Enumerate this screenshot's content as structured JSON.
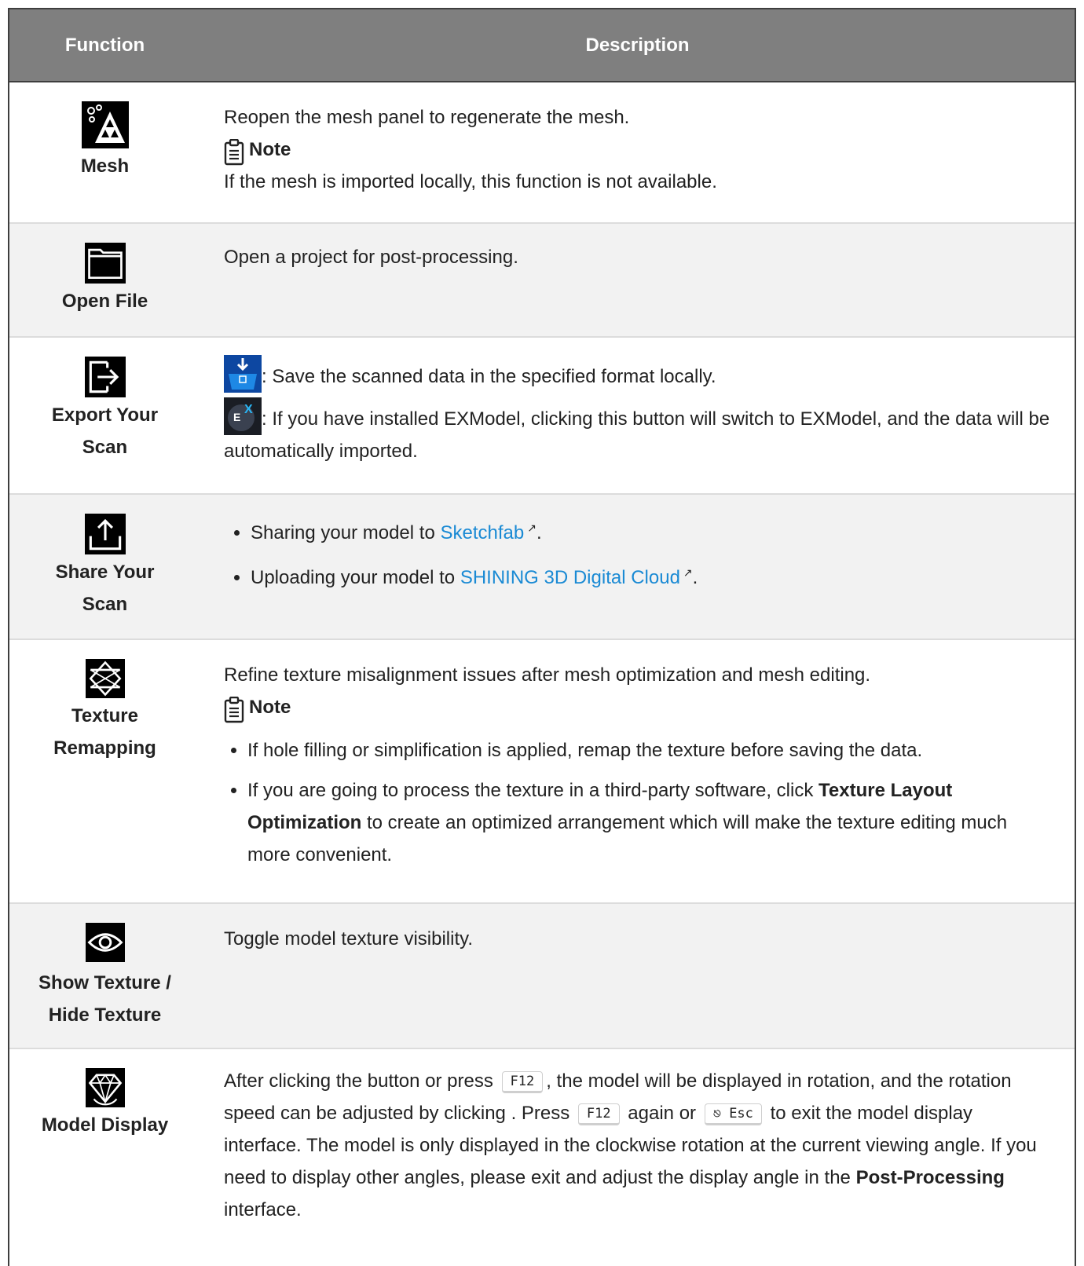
{
  "header": {
    "col1": "Function",
    "col2": "Description"
  },
  "rows": [
    {
      "icon": "mesh-icon",
      "name": "Mesh",
      "text": "Reopen the mesh panel to regenerate the mesh.",
      "note_label": "Note",
      "note_text": "If the mesh is imported locally, this function is not available."
    },
    {
      "icon": "folder-icon",
      "name": "Open File",
      "text": "Open a project for post-processing."
    },
    {
      "icon": "export-icon",
      "name_line1": "Export Your",
      "name_line2": "Scan",
      "line1": ": Save the scanned data in the specified format locally.",
      "line2": ": If you have installed EXModel, clicking this button will switch to EXModel, and the data will be automatically imported."
    },
    {
      "icon": "share-icon",
      "name_line1": "Share Your",
      "name_line2": "Scan",
      "bullet1_pre": "Sharing your model to ",
      "bullet1_link": "Sketchfab",
      "bullet1_post": ".",
      "bullet2_pre": "Uploading your model to ",
      "bullet2_link": "SHINING 3D Digital Cloud",
      "bullet2_post": ".",
      "ext_glyph": "↗"
    },
    {
      "icon": "texture-remap-icon",
      "name_line1": "Texture",
      "name_line2": "Remapping",
      "text": "Refine texture misalignment issues after mesh optimization and mesh editing.",
      "note_label": "Note",
      "bullet1": "If hole filling or simplification is applied, remap the texture before saving the data.",
      "bullet2_pre": "If you are going to process the texture in a third-party software, click ",
      "bullet2_bold": "Texture Layout Optimization",
      "bullet2_post": " to create an optimized arrangement which will make the texture editing much more convenient."
    },
    {
      "icon": "eye-icon",
      "name_line1": "Show Texture /",
      "name_line2": "Hide Texture",
      "text": "Toggle model texture visibility."
    },
    {
      "icon": "diamond-rotate-icon",
      "name": "Model Display",
      "t1": "After clicking the button or press ",
      "key1": "F12",
      "t2": ", the model will be displayed in rotation, and the rotation speed can be adjusted by clicking . Press ",
      "key2": "F12",
      "t3": " again or ",
      "key3": "⎋ Esc",
      "t4": " to exit the model display interface. The model is only displayed in the clockwise rotation at the current viewing angle. If you need to display other angles, please exit and adjust the display angle in the ",
      "bold": "Post-Processing",
      "t5": " interface."
    }
  ]
}
